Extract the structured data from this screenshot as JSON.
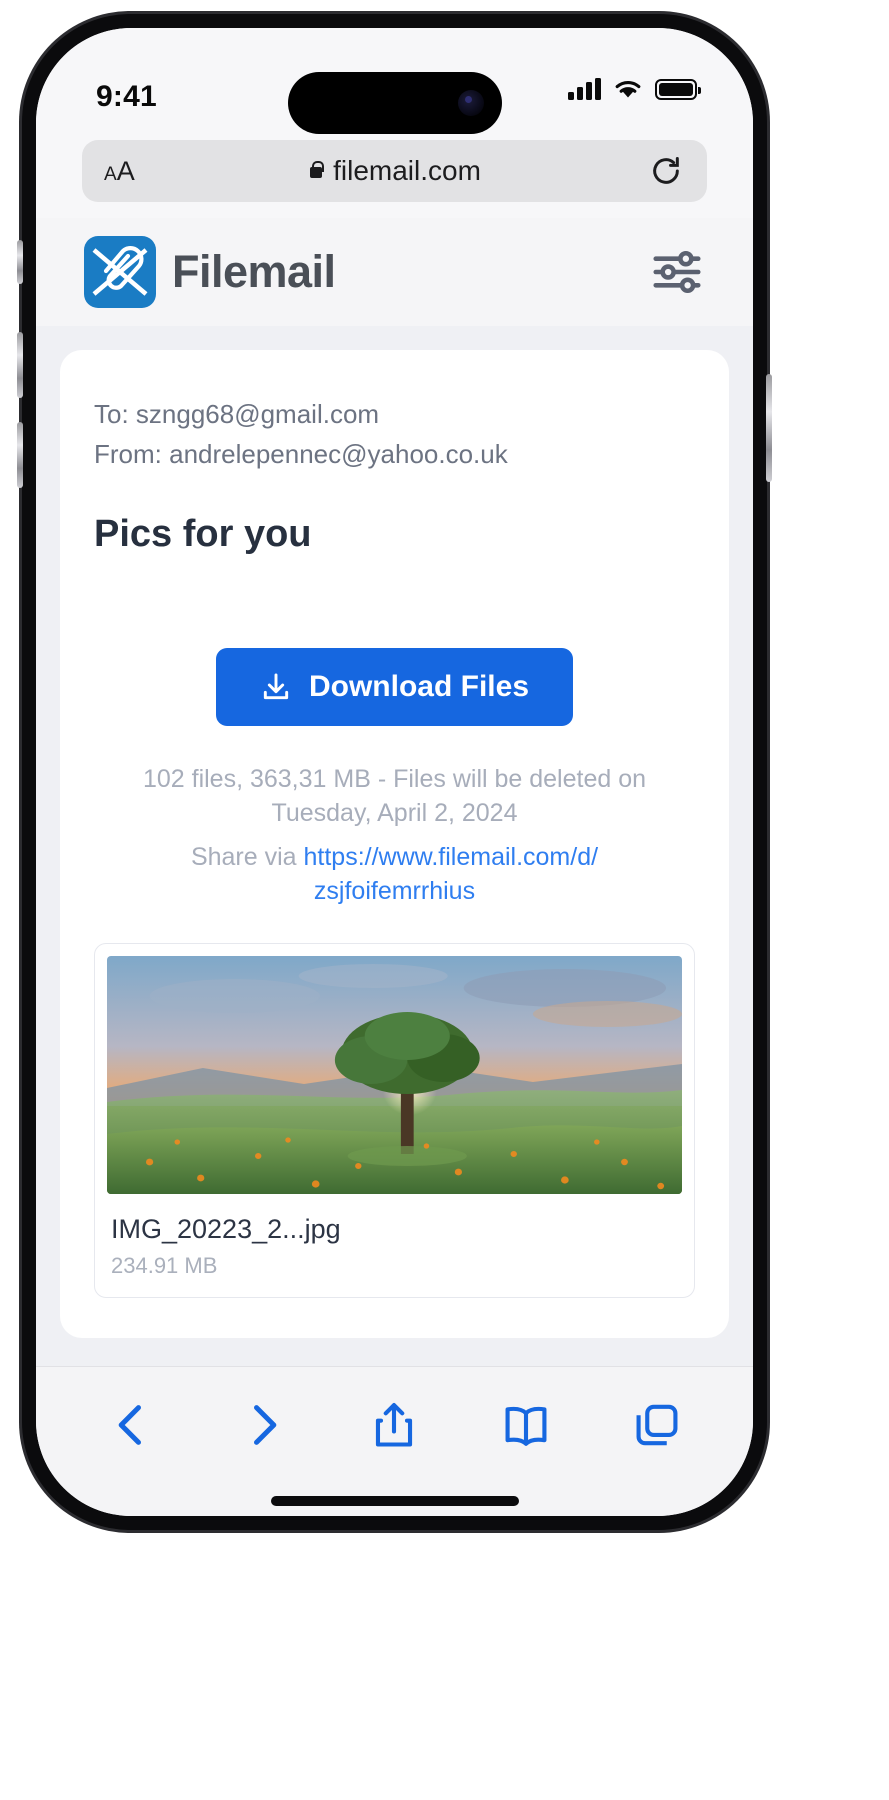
{
  "status_bar": {
    "time": "9:41",
    "signal_icon": "cellular-bars-icon",
    "wifi_icon": "wifi-icon",
    "battery_icon": "battery-icon"
  },
  "browser": {
    "text_size_small": "A",
    "text_size_large": "A",
    "lock_icon": "lock-icon",
    "url": "filemail.com",
    "reload_icon": "reload-icon",
    "toolbar": {
      "back": "back-chevron-icon",
      "forward": "forward-chevron-icon",
      "share": "share-icon",
      "bookmarks": "book-icon",
      "tabs": "tabs-icon"
    }
  },
  "site_header": {
    "brand": "Filemail",
    "logo_icon": "filemail-logo-icon",
    "settings_icon": "sliders-icon",
    "brand_color": "#1a7cc4",
    "wordmark_color": "#4a4f57"
  },
  "transfer": {
    "to_label": "To: szngg68@gmail.com",
    "from_label": "From: andrelepennec@yahoo.co.uk",
    "title": "Pics for you",
    "download_button": "Download Files",
    "download_icon": "download-icon",
    "accent_color": "#1667e0",
    "meta_line_1": "102 files, 363,31 MB - Files will be deleted on",
    "meta_line_2": "Tuesday, April 2, 2024",
    "share_prefix": "Share via ",
    "share_url_line_1": "https://www.filemail.com/d/",
    "share_url_line_2": "zsjfoifemrrhius",
    "link_color": "#2f7ef0",
    "files": [
      {
        "name": "IMG_20223_2...jpg",
        "size": "234.91 MB",
        "thumbnail": "sunset-tree-landscape-photo"
      }
    ]
  }
}
